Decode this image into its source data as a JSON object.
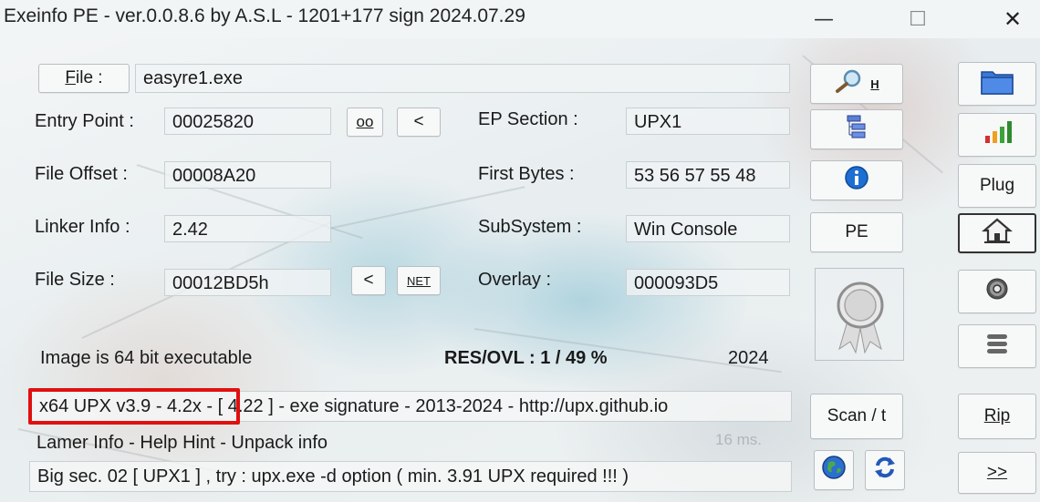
{
  "window": {
    "title": "Exeinfo PE - ver.0.0.8.6  by A.S.L -  1201+177 sign  2024.07.29",
    "controls": {
      "minimize": "—",
      "maximize": "☐",
      "close": "✕"
    }
  },
  "file": {
    "button_label": "File :",
    "button_underline": "F",
    "value": "easyre1.exe"
  },
  "entry_point": {
    "label": "Entry Point :",
    "value": "00025820",
    "oo_button": "oo",
    "prev_button": "<"
  },
  "file_offset": {
    "label": "File Offset :",
    "value": "00008A20"
  },
  "linker_info": {
    "label": "Linker Info :",
    "value": "2.42"
  },
  "file_size": {
    "label": "File Size :",
    "value": "00012BD5h",
    "prev_button": "<",
    "net_button": "NET"
  },
  "ep_section": {
    "label": "EP Section :",
    "value": "UPX1"
  },
  "first_bytes": {
    "label": "First Bytes :",
    "value": "53 56 57 55 48"
  },
  "subsystem": {
    "label": "SubSystem :",
    "value": "Win Console"
  },
  "overlay": {
    "label": "Overlay :",
    "value": "000093D5"
  },
  "image_info": {
    "text": "Image is 64 bit executable",
    "res_ovl": "RES/OVL : 1 / 49 %",
    "year": "2024"
  },
  "signature": {
    "text": "x64 UPX v3.9 - 4.2x - [ 4.22 ] - exe signature - 2013-2024 - http://upx.github.io",
    "highlight_color": "#e01010"
  },
  "lamer_info": {
    "text": "Lamer Info - Help Hint - Unpack info",
    "timing": "16 ms."
  },
  "big_sec": {
    "text": "Big sec. 02 [ UPX1 ] , try : upx.exe -d option ( min. 3.91 UPX required !!! )"
  },
  "tools_col1": {
    "search_hex": "H",
    "pe_button": "PE",
    "scan_button": "Scan / t"
  },
  "tools_col2": {
    "plug_button": "Plug",
    "rip_button": "Rip",
    "next_button": ">>"
  }
}
